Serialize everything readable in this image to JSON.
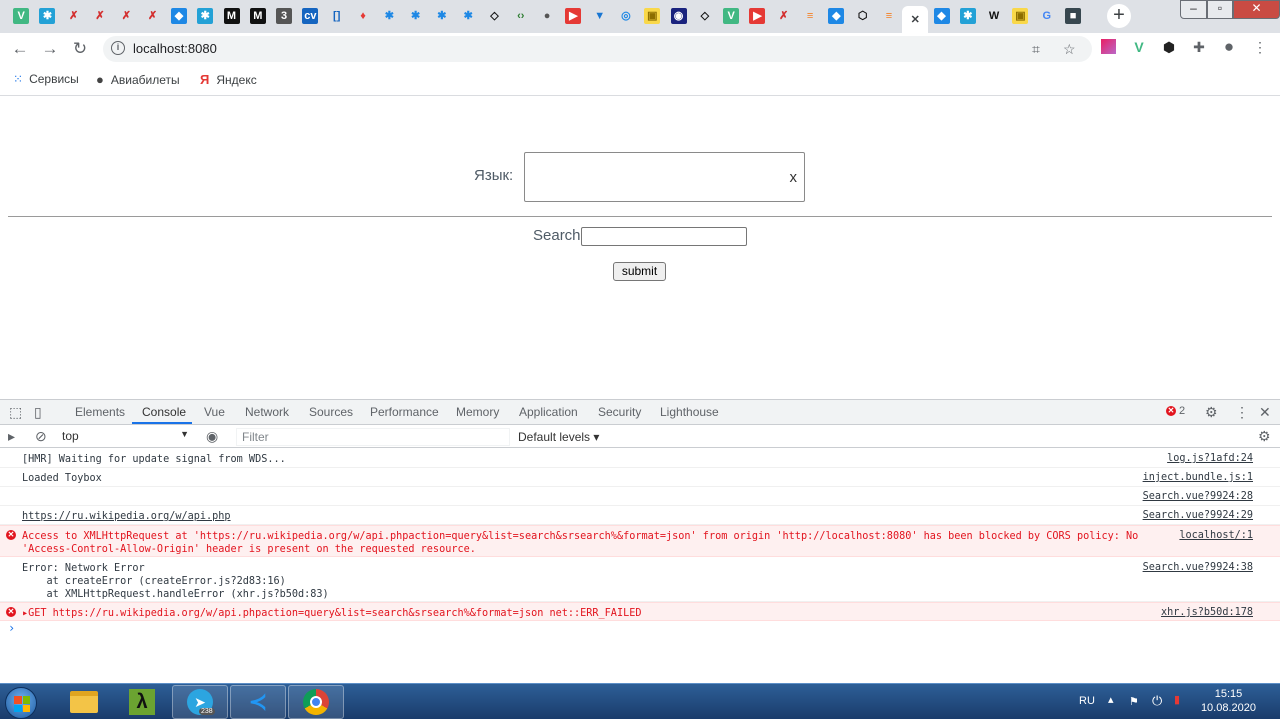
{
  "browser": {
    "tabs": [
      {
        "icon": "vue-icon",
        "glyph": "V",
        "fg": "#fff",
        "bg": "#41b883"
      },
      {
        "icon": "react-icon",
        "glyph": "✱",
        "fg": "#fff",
        "bg": "#23a1d6"
      },
      {
        "icon": "figure-icon",
        "glyph": "✗",
        "fg": "#d32f2f",
        "bg": "transparent"
      },
      {
        "icon": "figure-icon",
        "glyph": "✗",
        "fg": "#d32f2f",
        "bg": "transparent"
      },
      {
        "icon": "figure-icon",
        "glyph": "✗",
        "fg": "#d32f2f",
        "bg": "transparent"
      },
      {
        "icon": "figure-icon",
        "glyph": "✗",
        "fg": "#d32f2f",
        "bg": "transparent"
      },
      {
        "icon": "mortarboard-icon",
        "glyph": "◆",
        "fg": "#fff",
        "bg": "#1e88e5"
      },
      {
        "icon": "react-icon",
        "glyph": "✱",
        "fg": "#fff",
        "bg": "#23a1d6"
      },
      {
        "icon": "medium-icon",
        "glyph": "M",
        "fg": "#fff",
        "bg": "#111"
      },
      {
        "icon": "medium-icon",
        "glyph": "M",
        "fg": "#fff",
        "bg": "#111"
      },
      {
        "icon": "number-icon",
        "glyph": "3",
        "fg": "#fff",
        "bg": "#555"
      },
      {
        "icon": "cv-icon",
        "glyph": "cv",
        "fg": "#fff",
        "bg": "#1565c0"
      },
      {
        "icon": "brackets-icon",
        "glyph": "[]",
        "fg": "#1565c0",
        "bg": "transparent"
      },
      {
        "icon": "flame-icon",
        "glyph": "♦",
        "fg": "#e53935",
        "bg": "transparent"
      },
      {
        "icon": "snowflake-icon",
        "glyph": "✱",
        "fg": "#1e88e5",
        "bg": "transparent"
      },
      {
        "icon": "snowflake-icon",
        "glyph": "✱",
        "fg": "#1e88e5",
        "bg": "transparent"
      },
      {
        "icon": "snowflake-icon",
        "glyph": "✱",
        "fg": "#1e88e5",
        "bg": "transparent"
      },
      {
        "icon": "snowflake-icon",
        "glyph": "✱",
        "fg": "#1e88e5",
        "bg": "transparent"
      },
      {
        "icon": "codepen-icon",
        "glyph": "◇",
        "fg": "#111",
        "bg": "transparent"
      },
      {
        "icon": "code-icon",
        "glyph": "‹›",
        "fg": "#2e7d32",
        "bg": "transparent"
      },
      {
        "icon": "github-icon",
        "glyph": "●",
        "fg": "#555",
        "bg": "transparent"
      },
      {
        "icon": "youtube-icon",
        "glyph": "▶",
        "fg": "#fff",
        "bg": "#e53935"
      },
      {
        "icon": "vuetify-icon",
        "glyph": "▼",
        "fg": "#1976d2",
        "bg": "transparent"
      },
      {
        "icon": "refresh-icon",
        "glyph": "◎",
        "fg": "#1e88e5",
        "bg": "transparent"
      },
      {
        "icon": "bookmark-icon",
        "glyph": "▣",
        "fg": "#8d6e00",
        "bg": "#f9d84a"
      },
      {
        "icon": "owl-icon",
        "glyph": "◉",
        "fg": "#fff",
        "bg": "#1a237e"
      },
      {
        "icon": "codepen-icon",
        "glyph": "◇",
        "fg": "#111",
        "bg": "transparent"
      },
      {
        "icon": "vue-icon",
        "glyph": "V",
        "fg": "#fff",
        "bg": "#41b883"
      },
      {
        "icon": "youtube-icon",
        "glyph": "▶",
        "fg": "#fff",
        "bg": "#e53935"
      },
      {
        "icon": "figure-icon",
        "glyph": "✗",
        "fg": "#d32f2f",
        "bg": "transparent"
      },
      {
        "icon": "stackoverflow-icon",
        "glyph": "≡",
        "fg": "#f48024",
        "bg": "transparent"
      },
      {
        "icon": "mortarboard-icon",
        "glyph": "◆",
        "fg": "#fff",
        "bg": "#1e88e5"
      },
      {
        "icon": "hexagon-icon",
        "glyph": "⬡",
        "fg": "#111",
        "bg": "transparent"
      },
      {
        "icon": "stackoverflow-icon",
        "glyph": "≡",
        "fg": "#f48024",
        "bg": "transparent"
      },
      {
        "icon": "close-icon",
        "glyph": "✕",
        "fg": "#3c4043",
        "bg": "transparent",
        "active": true
      },
      {
        "icon": "mortarboard-icon",
        "glyph": "◆",
        "fg": "#fff",
        "bg": "#1e88e5"
      },
      {
        "icon": "react-icon",
        "glyph": "✱",
        "fg": "#fff",
        "bg": "#23a1d6"
      },
      {
        "icon": "wikipedia-icon",
        "glyph": "W",
        "fg": "#111",
        "bg": "transparent"
      },
      {
        "icon": "bookmark-icon",
        "glyph": "▣",
        "fg": "#8d6e00",
        "bg": "#f9d84a"
      },
      {
        "icon": "google-icon",
        "glyph": "G",
        "fg": "#4285f4",
        "bg": "transparent"
      },
      {
        "icon": "square-icon",
        "glyph": "■",
        "fg": "#fff",
        "bg": "#37474f"
      }
    ],
    "url": "localhost:8080",
    "bookmarks": [
      {
        "label": "Сервисы",
        "icon": "apps-grid-icon"
      },
      {
        "label": "Авиабилеты",
        "icon": "globe-icon"
      },
      {
        "label": "Яндекс",
        "icon": "yandex-icon"
      }
    ]
  },
  "page": {
    "lang_label": "Язык:",
    "lang_clear": "x",
    "search_label": "Search",
    "search_value": "",
    "submit_label": "submit"
  },
  "devtools": {
    "tabs": [
      "Elements",
      "Console",
      "Vue",
      "Network",
      "Sources",
      "Performance",
      "Memory",
      "Application",
      "Security",
      "Lighthouse"
    ],
    "active_tab": "Console",
    "error_count": "2",
    "context": "top",
    "filter_placeholder": "Filter",
    "levels": "Default levels ▾",
    "messages": [
      {
        "text": "[HMR] Waiting for update signal from WDS...",
        "source": "log.js?1afd:24"
      },
      {
        "text": "Loaded Toybox",
        "source": "inject.bundle.js:1"
      },
      {
        "text": "",
        "source": "Search.vue?9924:28"
      },
      {
        "text": "https://ru.wikipedia.org/w/api.php",
        "source": "Search.vue?9924:29"
      },
      {
        "text": "Access to XMLHttpRequest at 'https://ru.wikipedia.org/w/api.phpaction=query&list=search&srsearch%&format=json' from origin 'http://localhost:8080' has been blocked by CORS policy: No\n'Access-Control-Allow-Origin' header is present on the requested resource.",
        "source": "localhost/:1"
      },
      {
        "text": "Error: Network Error\n    at createError (createError.js?2d83:16)\n    at XMLHttpRequest.handleError (xhr.js?b50d:83)",
        "source": "Search.vue?9924:38"
      },
      {
        "text": "▸GET https://ru.wikipedia.org/w/api.phpaction=query&list=search&srsearch%&format=json net::ERR_FAILED",
        "source": "xhr.js?b50d:178"
      }
    ],
    "prompt": "›"
  },
  "taskbar": {
    "apps": [
      {
        "icon": "file-explorer-icon",
        "badge": ""
      },
      {
        "icon": "lambda-icon",
        "badge": ""
      },
      {
        "icon": "telegram-icon",
        "badge": "238"
      },
      {
        "icon": "vscode-icon",
        "badge": ""
      },
      {
        "icon": "chrome-icon",
        "badge": ""
      }
    ],
    "lang": "RU",
    "time": "15:15",
    "date": "10.08.2020"
  }
}
